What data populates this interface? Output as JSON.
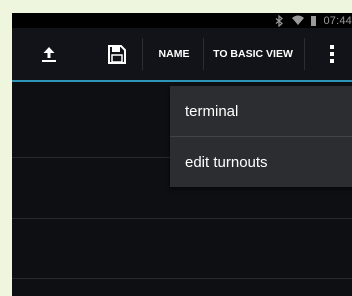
{
  "status_bar": {
    "time": "07:44"
  },
  "action_bar": {
    "name_label": "NAME",
    "basic_view_label": "TO BASIC VIEW"
  },
  "overflow_menu": {
    "items": [
      {
        "label": "terminal"
      },
      {
        "label": "edit turnouts"
      }
    ]
  },
  "colors": {
    "accent": "#2f95b8",
    "action_bar_bg": "#111318",
    "menu_bg": "#2b2d30",
    "frame_bg": "#eef6dd"
  }
}
